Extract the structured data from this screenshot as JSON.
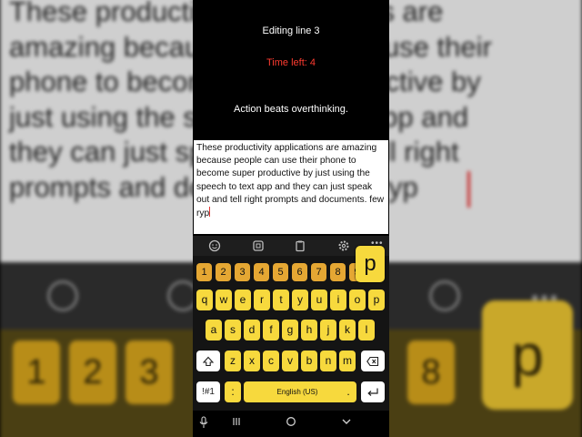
{
  "background": {
    "text": "These productivity applications are\namazing because people can use their\nphone to become super productive by\njust using the speech to text app and\nthey can just speak out and tell right\nprompts and documents. few ryp",
    "number_keys": [
      "1",
      "2",
      "3",
      "8"
    ],
    "popup_key": "p"
  },
  "header": {
    "editing_label": "Editing line 3",
    "time_left": "Time left: 4",
    "time_left_color": "#ff3b30",
    "motto": "Action beats overthinking."
  },
  "editor": {
    "text": "These productivity applications are amazing because people can use their phone to become super productive by just using the speech to text app and they can just speak out and tell right prompts and documents. few ryp"
  },
  "toolbar": {
    "icons": [
      "emoji-icon",
      "sticker-icon",
      "clipboard-icon",
      "settings-icon",
      "more-icon"
    ]
  },
  "keyboard": {
    "accent_color": "#f7d93d",
    "number_color": "#e5a733",
    "numbers": [
      "1",
      "2",
      "3",
      "4",
      "5",
      "6",
      "7",
      "8",
      "9",
      "0"
    ],
    "row1": [
      "q",
      "w",
      "e",
      "r",
      "t",
      "y",
      "u",
      "i",
      "o",
      "p"
    ],
    "row2": [
      "a",
      "s",
      "d",
      "f",
      "g",
      "h",
      "j",
      "k",
      "l"
    ],
    "row3": [
      "z",
      "x",
      "c",
      "v",
      "b",
      "n",
      "m"
    ],
    "symbols_label": "!#1",
    "colon_label": ":",
    "space_label": "English (US)",
    "period_label": ".",
    "popup_key": "p"
  }
}
